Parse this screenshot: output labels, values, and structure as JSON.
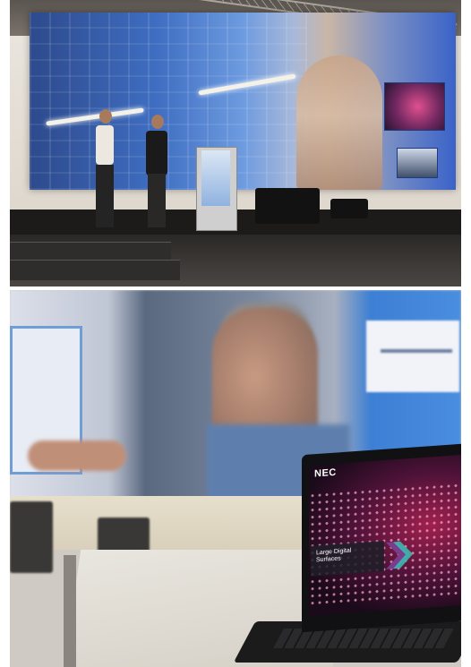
{
  "laptop": {
    "brand": "NEC",
    "screen_title_line1": "Large Digital",
    "screen_title_line2": "Surfaces"
  },
  "colors": {
    "led_wall_blue": "#3f6ec2",
    "screen_magenta": "#a0204e",
    "chevron_purple": "#7a3c8c",
    "chevron_teal": "#3cb8b0"
  }
}
